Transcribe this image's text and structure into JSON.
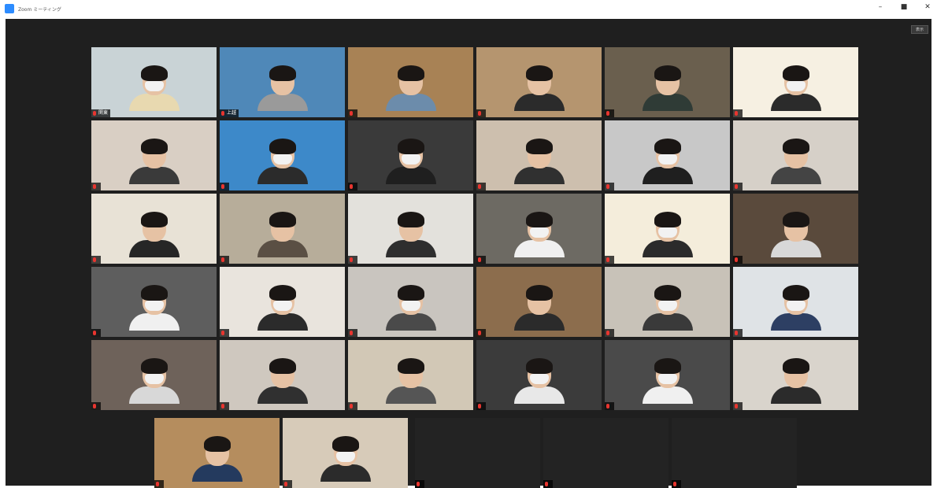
{
  "window": {
    "title": "Zoom ミーティング",
    "controls": {
      "minimize": "–",
      "maximize": "■",
      "close": "✕"
    }
  },
  "toolbar": {
    "view_label": "表示"
  },
  "colors": {
    "background": "#1f1f1f",
    "active_speaker": "#e8d41f",
    "mic_muted": "#e8352f"
  },
  "participants": [
    {
      "name": "関東",
      "video": true,
      "mask": true,
      "bg": "#c9d3d6",
      "shirt": "#e8d9b0"
    },
    {
      "name": "上越",
      "video": true,
      "mask": false,
      "bg": "#4f88b8",
      "shirt": "#9a9a9a"
    },
    {
      "name": "",
      "video": true,
      "mask": false,
      "bg": "#a88255",
      "shirt": "#6c8cab"
    },
    {
      "name": "",
      "video": true,
      "mask": false,
      "bg": "#b5956f",
      "shirt": "#2b2b2b"
    },
    {
      "name": "",
      "video": true,
      "mask": false,
      "bg": "#6a5f4e",
      "shirt": "#2f3b36"
    },
    {
      "name": "",
      "video": true,
      "mask": true,
      "bg": "#f6f0e2",
      "shirt": "#2b2b2b",
      "speaking": true
    },
    {
      "name": "",
      "video": true,
      "mask": false,
      "bg": "#d9cfc4",
      "shirt": "#3a3a3a"
    },
    {
      "name": "",
      "video": true,
      "mask": true,
      "bg": "#3d89c9",
      "shirt": "#2b2b2b"
    },
    {
      "name": "",
      "video": true,
      "mask": true,
      "bg": "#3a3a3a",
      "shirt": "#1f1f1f"
    },
    {
      "name": "",
      "video": true,
      "mask": false,
      "bg": "#cdbfae",
      "shirt": "#303030"
    },
    {
      "name": "",
      "video": true,
      "mask": true,
      "bg": "#c8c8c8",
      "shirt": "#1f1f1f"
    },
    {
      "name": "",
      "video": true,
      "mask": false,
      "bg": "#d6d0c8",
      "shirt": "#444444"
    },
    {
      "name": "",
      "video": true,
      "mask": false,
      "bg": "#e8e2d6",
      "shirt": "#262626"
    },
    {
      "name": "",
      "video": true,
      "mask": false,
      "bg": "#b7ad9a",
      "shirt": "#5a4f44"
    },
    {
      "name": "",
      "video": true,
      "mask": false,
      "bg": "#e3e1dc",
      "shirt": "#2e2e2e"
    },
    {
      "name": "",
      "video": true,
      "mask": true,
      "bg": "#6d6a63",
      "shirt": "#f0f0f0"
    },
    {
      "name": "",
      "video": true,
      "mask": true,
      "bg": "#f4eddb",
      "shirt": "#2b2b2b",
      "speaking": true
    },
    {
      "name": "",
      "video": true,
      "mask": false,
      "bg": "#5a4a3c",
      "shirt": "#d8d8d8"
    },
    {
      "name": "",
      "video": true,
      "mask": true,
      "bg": "#5e5e5e",
      "shirt": "#f0f0f0"
    },
    {
      "name": "",
      "video": true,
      "mask": true,
      "bg": "#e9e4dd",
      "shirt": "#2b2b2b"
    },
    {
      "name": "",
      "video": true,
      "mask": true,
      "bg": "#c9c5bf",
      "shirt": "#4a4a4a"
    },
    {
      "name": "",
      "video": true,
      "mask": false,
      "bg": "#8c6d4d",
      "shirt": "#2b2b2b"
    },
    {
      "name": "",
      "video": true,
      "mask": true,
      "bg": "#c8c2b8",
      "shirt": "#3a3a3a"
    },
    {
      "name": "",
      "video": true,
      "mask": true,
      "bg": "#dfe3e6",
      "shirt": "#2d3f63"
    },
    {
      "name": "",
      "video": true,
      "mask": true,
      "bg": "#6e625a",
      "shirt": "#d8d8d8"
    },
    {
      "name": "",
      "video": true,
      "mask": false,
      "bg": "#cfc8bf",
      "shirt": "#303030"
    },
    {
      "name": "",
      "video": true,
      "mask": false,
      "bg": "#d2c8b6",
      "shirt": "#555555"
    },
    {
      "name": "",
      "video": true,
      "mask": true,
      "bg": "#3b3b3b",
      "shirt": "#e8e8e8"
    },
    {
      "name": "",
      "video": true,
      "mask": true,
      "bg": "#4a4a4a",
      "shirt": "#f0f0f0"
    },
    {
      "name": "",
      "video": true,
      "mask": false,
      "bg": "#d9d4cc",
      "shirt": "#2b2b2b"
    },
    {
      "name": "",
      "video": true,
      "mask": false,
      "bg": "#b58d5e",
      "shirt": "#243a5e"
    },
    {
      "name": "",
      "video": true,
      "mask": true,
      "bg": "#d7cbb9",
      "shirt": "#2b2b2b"
    },
    {
      "name": "",
      "video": false,
      "display_name": ""
    },
    {
      "name": "",
      "video": false,
      "display_name": ""
    },
    {
      "name": "",
      "video": false,
      "display_name": ""
    }
  ]
}
